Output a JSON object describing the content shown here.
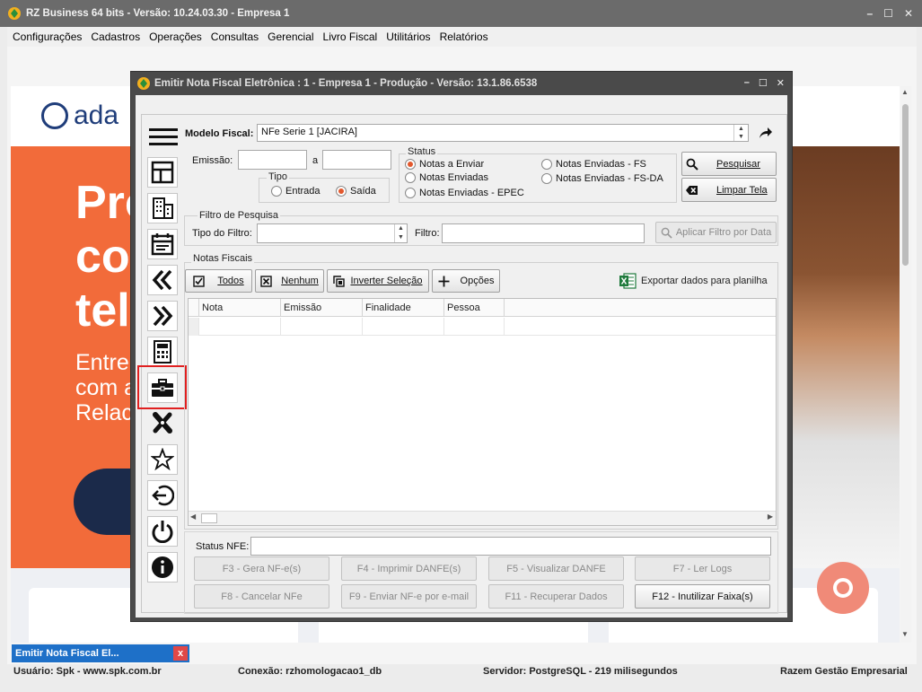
{
  "app": {
    "title": "RZ Business 64 bits -  Versão: 10.24.03.30  -  Empresa 1",
    "window_buttons": [
      "–",
      "☐",
      "✕"
    ],
    "menu": [
      "Configurações",
      "Cadastros",
      "Operações",
      "Consultas",
      "Gerencial",
      "Livro Fiscal",
      "Utilitários",
      "Relatórios"
    ]
  },
  "website": {
    "logo_text": "ada",
    "hero_lines": [
      "Pro",
      "co",
      "tel"
    ],
    "sub_lines": [
      "Entre",
      "com a",
      "Relac"
    ]
  },
  "dialog": {
    "title": "Emitir Nota Fiscal Eletrônica : 1 - Empresa 1 - Produção - Versão: 13.1.86.6538",
    "modelo_label": "Modelo Fiscal:",
    "modelo_value": "NFe Serie 1 [JACIRA]",
    "emissao_label": "Emissão:",
    "emissao_from": "",
    "emissao_sep": "a",
    "emissao_to": "",
    "tipo": {
      "title": "Tipo",
      "entrada": "Entrada",
      "saida": "Saída",
      "selected": "saida"
    },
    "status": {
      "title": "Status",
      "options": [
        "Notas a Enviar",
        "Notas Enviadas",
        "Notas Enviadas - EPEC",
        "Notas Enviadas - FS",
        "Notas Enviadas - FS-DA"
      ],
      "selected": 0
    },
    "pesquisar": "Pesquisar",
    "limpar": "Limpar Tela",
    "filtro": {
      "title": "Filtro de Pesquisa",
      "tipo_label": "Tipo do Filtro:",
      "tipo_value": "",
      "filtro_label": "Filtro:",
      "filtro_value": "",
      "aplicar": "Aplicar Filtro por Data"
    },
    "notas": {
      "title": "Notas Fiscais",
      "todos": "Todos",
      "nenhum": "Nenhum",
      "inverter": "Inverter Seleção",
      "opcoes": "Opções",
      "exportar": "Exportar dados para planilha",
      "columns": [
        "Nota",
        "Emissão",
        "Finalidade",
        "Pessoa"
      ]
    },
    "status_nfe_label": "Status NFE:",
    "status_nfe_value": "",
    "fkeys": [
      "F3 - Gera NF-e(s)",
      "F4 - Imprimir DANFE(s)",
      "F5 - Visualizar DANFE",
      "F7 - Ler Logs",
      "F8 - Cancelar NFe",
      "F9 - Enviar NF-e por e-mail",
      "F11 - Recuperar Dados",
      "F12 - Inutilizar Faixa(s)"
    ],
    "side_icons": [
      "menu-icon",
      "layout-icon",
      "building-icon",
      "calendar-icon",
      "double-chevron-left-icon",
      "double-chevron-right-icon",
      "calculator-icon",
      "briefcase-icon",
      "tools-icon",
      "star-icon",
      "logout-icon",
      "power-icon",
      "info-icon"
    ]
  },
  "taskbar": {
    "label": "Emitir Nota Fiscal El...",
    "close": "x"
  },
  "statusbar": {
    "usuario": "Usuário: Spk - www.spk.com.br",
    "conexao": "Conexão: rzhomologacao1_db",
    "servidor": "Servidor: PostgreSQL - 219 milisegundos",
    "empresa": "Razem Gestão Empresarial"
  },
  "colors": {
    "titlebar": "#6b6b6b",
    "accent_orange": "#f26b3a",
    "radio_selected": "#e2582d",
    "highlight_red": "#e02020",
    "taskbar_blue": "#1e70c8"
  }
}
